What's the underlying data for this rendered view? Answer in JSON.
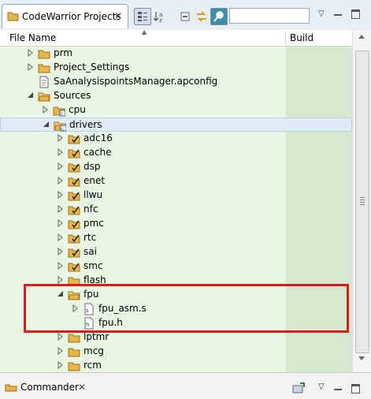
{
  "view": {
    "tab_title": "CodeWarrior Projects",
    "close_glyph": "✕",
    "icons": [
      "collapse-all-icon",
      "sort-az-icon",
      "collapse-tree-icon",
      "link-with-editor-icon",
      "search-icon"
    ],
    "search_value": "",
    "menu_glyph": "▽"
  },
  "columns": {
    "file_name": "File Name",
    "build": "Build",
    "sort_glyph": "▲"
  },
  "tree": [
    {
      "label": "prm",
      "depth": 1,
      "type": "folder",
      "expand": "collapsed"
    },
    {
      "label": "Project_Settings",
      "depth": 1,
      "type": "folder",
      "expand": "collapsed"
    },
    {
      "label": "SaAnalysispointsManager.apconfig",
      "depth": 1,
      "type": "file",
      "expand": "none"
    },
    {
      "label": "Sources",
      "depth": 1,
      "type": "folder-open",
      "expand": "expanded"
    },
    {
      "label": "cpu",
      "depth": 2,
      "type": "source-folder",
      "expand": "collapsed"
    },
    {
      "label": "drivers",
      "depth": 2,
      "type": "source-folder-open",
      "expand": "expanded",
      "selected": true
    },
    {
      "label": "adc16",
      "depth": 3,
      "type": "folder-checked",
      "expand": "collapsed"
    },
    {
      "label": "cache",
      "depth": 3,
      "type": "folder-checked",
      "expand": "collapsed"
    },
    {
      "label": "dsp",
      "depth": 3,
      "type": "folder-checked",
      "expand": "collapsed"
    },
    {
      "label": "enet",
      "depth": 3,
      "type": "folder-checked",
      "expand": "collapsed"
    },
    {
      "label": "llwu",
      "depth": 3,
      "type": "folder-checked",
      "expand": "collapsed"
    },
    {
      "label": "nfc",
      "depth": 3,
      "type": "folder-checked",
      "expand": "collapsed"
    },
    {
      "label": "pmc",
      "depth": 3,
      "type": "folder-checked",
      "expand": "collapsed"
    },
    {
      "label": "rtc",
      "depth": 3,
      "type": "folder-checked",
      "expand": "collapsed"
    },
    {
      "label": "sai",
      "depth": 3,
      "type": "folder-checked",
      "expand": "collapsed"
    },
    {
      "label": "smc",
      "depth": 3,
      "type": "folder-checked",
      "expand": "collapsed"
    },
    {
      "label": "flash",
      "depth": 3,
      "type": "folder",
      "expand": "collapsed"
    },
    {
      "label": "fpu",
      "depth": 3,
      "type": "folder-open",
      "expand": "expanded"
    },
    {
      "label": "fpu_asm.s",
      "depth": 4,
      "type": "asm-file",
      "expand": "collapsed"
    },
    {
      "label": "fpu.h",
      "depth": 4,
      "type": "header-file",
      "expand": "none"
    },
    {
      "label": "lptmr",
      "depth": 3,
      "type": "folder",
      "expand": "collapsed"
    },
    {
      "label": "mcg",
      "depth": 3,
      "type": "folder",
      "expand": "collapsed"
    },
    {
      "label": "rcm",
      "depth": 3,
      "type": "folder",
      "expand": "collapsed"
    }
  ],
  "commander": {
    "title": "Commander",
    "close_glyph": "✕",
    "menu_glyph": "▽"
  },
  "colors": {
    "tree_bg": "#e8f6e3",
    "build_col_bg": "#d6e9cf",
    "highlight": "#e0191c",
    "folder": "#e8b54a"
  }
}
